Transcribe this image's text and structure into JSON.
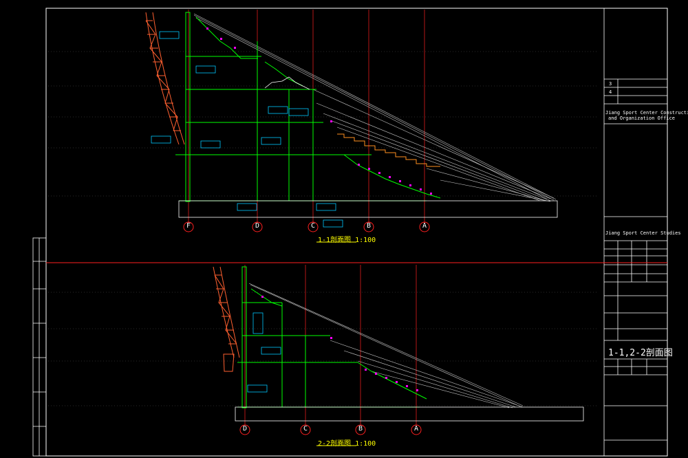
{
  "drawing": {
    "sections": [
      {
        "caption": "1-1剖面图 1:100",
        "axes": [
          "F",
          "D",
          "C",
          "B",
          "A"
        ]
      },
      {
        "caption": "2-2剖面图 1:100",
        "axes": [
          "D",
          "C",
          "B",
          "A"
        ]
      }
    ]
  },
  "title_block": {
    "org_en_1": "Jiang Sport Center Construction",
    "org_en_2": "and Organization Office",
    "studio_en": "Jiang Sport Center Studies",
    "drawing_title": "1-1,2-2剖面图",
    "rev_numbers": [
      "3",
      "4"
    ]
  },
  "colors": {
    "background": "#000000",
    "frame": "#ffffff",
    "section_line": "#ff2020",
    "structure": "#00ff00",
    "steel": "#ff6030",
    "roof": "#c8c8c8",
    "label_box": "#00c8ff",
    "magenta": "#ff00ff",
    "yellow": "#ffff00"
  }
}
